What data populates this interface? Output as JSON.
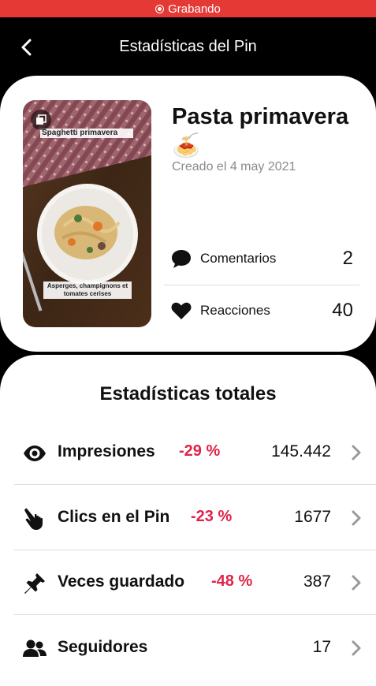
{
  "recording": {
    "label": "Grabando"
  },
  "header": {
    "title": "Estadísticas del Pin"
  },
  "pin": {
    "name": "Pasta primavera 🍝",
    "created": "Creado el 4 may 2021",
    "image": {
      "caption_top": "Spaghetti primavera",
      "caption_bottom": "Asperges, champignons et tomates cerises"
    },
    "comments": {
      "label": "Comentarios",
      "value": "2"
    },
    "reactions": {
      "label": "Reacciones",
      "value": "40"
    }
  },
  "totals": {
    "title": "Estadísticas totales",
    "rows": [
      {
        "label": "Impresiones",
        "change": "-29 %",
        "value": "145.442",
        "icon": "eye-icon"
      },
      {
        "label": "Clics en el Pin",
        "change": "-23 %",
        "value": "1677",
        "icon": "pointer-hand-icon"
      },
      {
        "label": "Veces guardado",
        "change": "-48 %",
        "value": "387",
        "icon": "pin-icon"
      },
      {
        "label": "Seguidores",
        "change": "",
        "value": "17",
        "icon": "people-icon"
      }
    ]
  },
  "colors": {
    "accent_negative": "#e0234a",
    "recording": "#e53935"
  }
}
